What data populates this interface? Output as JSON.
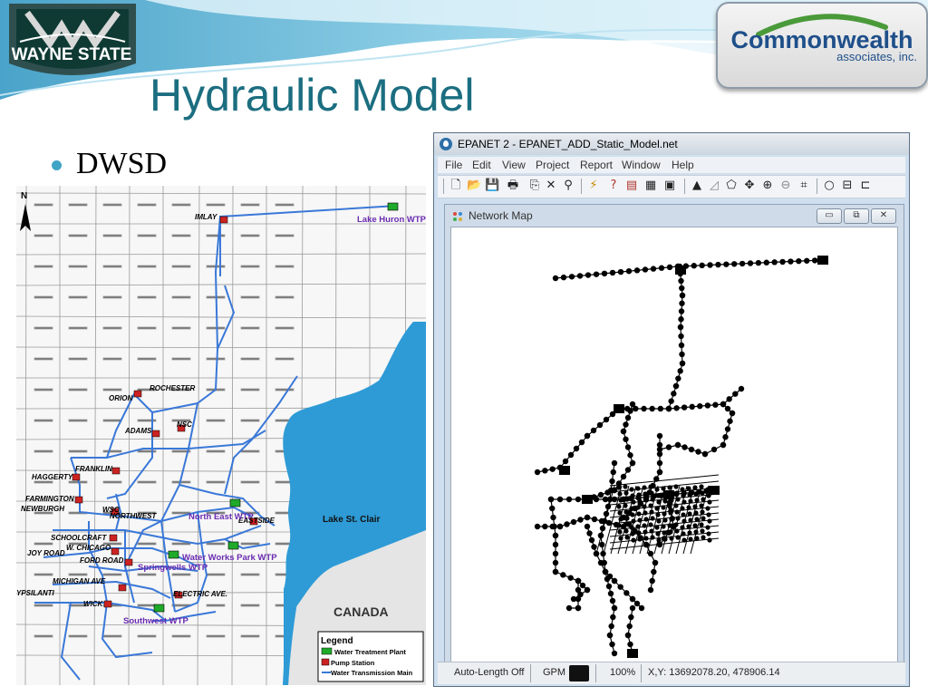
{
  "slide": {
    "title": "Hydraulic Model",
    "bullet": "DWSD",
    "logos": {
      "wayne_state": "WAYNE STATE",
      "commonwealth_name": "Commonwealth",
      "commonwealth_sub": "associates, inc."
    }
  },
  "map": {
    "north_label": "N",
    "cities": [
      "IMLAY",
      "ROCHESTER",
      "ORION",
      "ADAMS",
      "NSC",
      "FRANKLIN",
      "HAGGERTY",
      "FARMINGTON",
      "NEWBURGH",
      "WSC",
      "NORTHWEST",
      "SCHOOLCRAFT",
      "W. CHICAGO",
      "JOY ROAD",
      "FORD ROAD",
      "MICHIGAN AVE",
      "YPSILANTI",
      "WICK",
      "EASTSIDE",
      "ELECTRIC AVE."
    ],
    "plants": [
      "Lake Huron WTP",
      "North East WTP",
      "Water Works Park WTP",
      "Springwells WTP",
      "Southwest WTP"
    ],
    "areas": [
      "Lake St. Clair",
      "CANADA"
    ],
    "legend": {
      "title": "Legend",
      "items": [
        "Water Treatment Plant",
        "Pump Station",
        "Water Transmission Main"
      ]
    },
    "colors": {
      "water": "#2e9bd6",
      "mains": "#3a78d8",
      "plant_label": "#6a2bb0",
      "pump": "#cc2222",
      "plant_icon": "#1faa2a"
    }
  },
  "epanet": {
    "window_title": "EPANET 2 - EPANET_ADD_Static_Model.net",
    "menu": [
      "File",
      "Edit",
      "View",
      "Project",
      "Report",
      "Window",
      "Help"
    ],
    "toolbar_icons": [
      "new-icon",
      "open-icon",
      "save-icon",
      "print-icon",
      "copy-icon",
      "delete-icon",
      "find-icon",
      "run-icon",
      "query-icon",
      "graph-icon",
      "table-icon",
      "options-icon",
      "select-icon",
      "select-vertex-icon",
      "select-region-icon",
      "pan-icon",
      "zoom-in-icon",
      "zoom-out-icon",
      "full-extent-icon",
      "junction-icon",
      "reservoir-icon",
      "tank-icon"
    ],
    "child_window": {
      "title": "Network Map"
    },
    "status": {
      "auto_length": "Auto-Length Off",
      "flow_units": "GPM",
      "zoom": "100%",
      "xy": "X,Y: 13692078.20, 478906.14"
    }
  }
}
